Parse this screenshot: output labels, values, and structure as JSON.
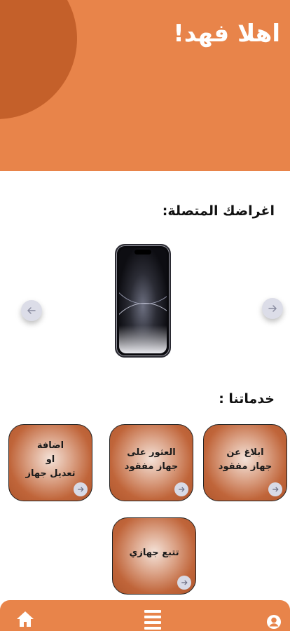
{
  "header": {
    "greeting": "اهلا فهد!"
  },
  "devices": {
    "title": "اغراضك المتصلة:"
  },
  "services": {
    "title": "خدماتنا :",
    "cards": [
      {
        "label": "ابلاغ عن\nجهاز مفقود"
      },
      {
        "label": "العثور على\nجهاز مفقود"
      },
      {
        "label": "اضافة\nاو\nتعديل جهاز"
      },
      {
        "label": "تتبع جهازي"
      }
    ]
  },
  "nav": {
    "items": [
      "home-icon",
      "menu-icon",
      "profile-icon"
    ]
  },
  "colors": {
    "accent": "#e8844a",
    "accent_dark": "#c4602a"
  }
}
